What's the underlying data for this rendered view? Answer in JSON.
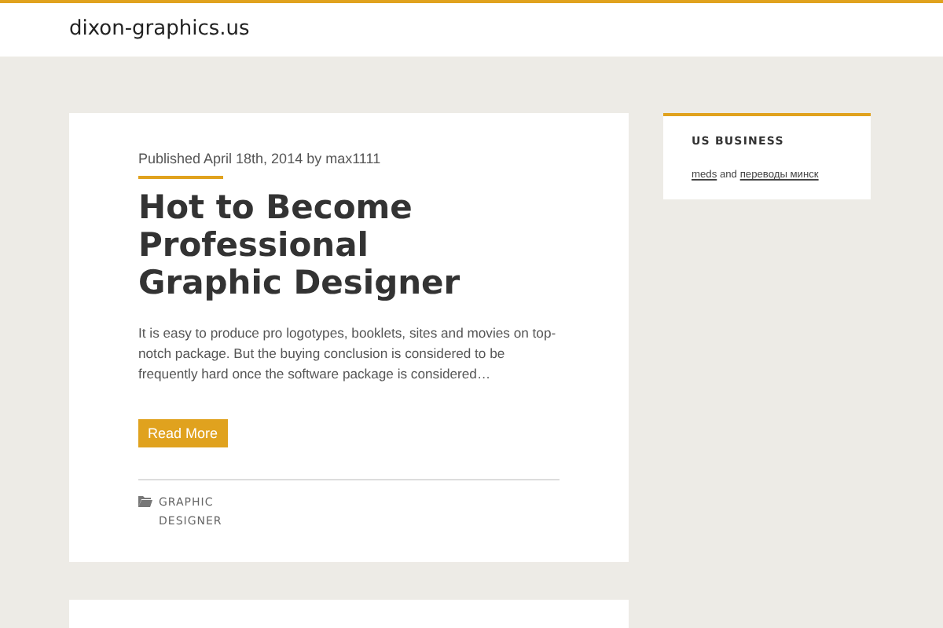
{
  "site_title": "dixon-graphics.us",
  "posts": [
    {
      "meta": "Published April 18th, 2014 by max1111",
      "title": "Hot to Become Professional Graphic Designer",
      "excerpt": "It is easy to produce pro logotypes, booklets, sites and movies on top-notch package. But the buying conclusion is considered to be frequently hard once the software package is considered…",
      "button": "Read More",
      "category": "GRAPHIC DESIGNER"
    }
  ],
  "sidebar": {
    "widget_title": "US BUSINESS",
    "body": [
      {
        "kind": "link",
        "text": "meds"
      },
      {
        "kind": "text",
        "text": "and"
      },
      {
        "kind": "link",
        "text": "переводы минск"
      }
    ]
  }
}
